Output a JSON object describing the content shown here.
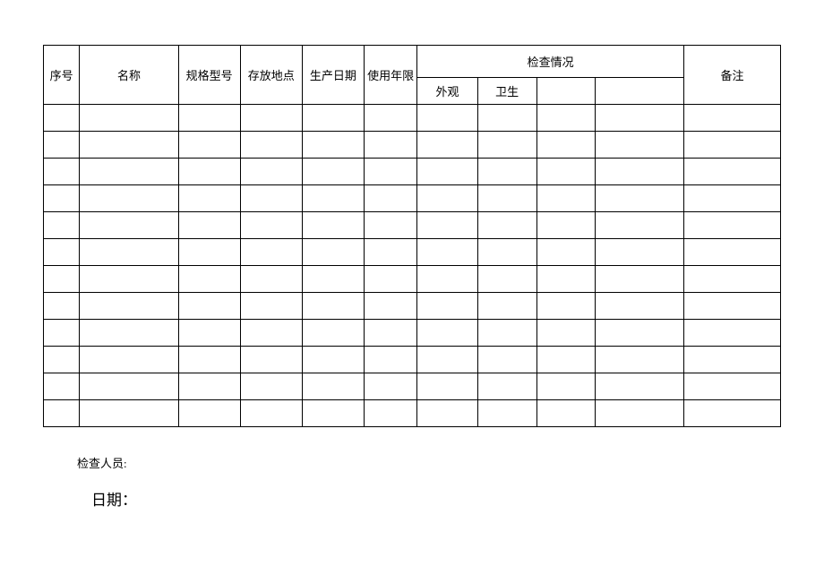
{
  "headers": {
    "seq": "序号",
    "name": "名称",
    "spec": "规格型号",
    "location": "存放地点",
    "prod_date": "生产日期",
    "lifetime": "使用年限",
    "inspection": "检查情况",
    "remark": "备注"
  },
  "sub_headers": {
    "appearance": "外观",
    "hygiene": "卫生",
    "sub3": "",
    "sub4": ""
  },
  "rows": [
    {
      "seq": "",
      "name": "",
      "spec": "",
      "loc": "",
      "date": "",
      "life": "",
      "s1": "",
      "s2": "",
      "s3": "",
      "s4": "",
      "remark": ""
    },
    {
      "seq": "",
      "name": "",
      "spec": "",
      "loc": "",
      "date": "",
      "life": "",
      "s1": "",
      "s2": "",
      "s3": "",
      "s4": "",
      "remark": ""
    },
    {
      "seq": "",
      "name": "",
      "spec": "",
      "loc": "",
      "date": "",
      "life": "",
      "s1": "",
      "s2": "",
      "s3": "",
      "s4": "",
      "remark": ""
    },
    {
      "seq": "",
      "name": "",
      "spec": "",
      "loc": "",
      "date": "",
      "life": "",
      "s1": "",
      "s2": "",
      "s3": "",
      "s4": "",
      "remark": ""
    },
    {
      "seq": "",
      "name": "",
      "spec": "",
      "loc": "",
      "date": "",
      "life": "",
      "s1": "",
      "s2": "",
      "s3": "",
      "s4": "",
      "remark": ""
    },
    {
      "seq": "",
      "name": "",
      "spec": "",
      "loc": "",
      "date": "",
      "life": "",
      "s1": "",
      "s2": "",
      "s3": "",
      "s4": "",
      "remark": ""
    },
    {
      "seq": "",
      "name": "",
      "spec": "",
      "loc": "",
      "date": "",
      "life": "",
      "s1": "",
      "s2": "",
      "s3": "",
      "s4": "",
      "remark": ""
    },
    {
      "seq": "",
      "name": "",
      "spec": "",
      "loc": "",
      "date": "",
      "life": "",
      "s1": "",
      "s2": "",
      "s3": "",
      "s4": "",
      "remark": ""
    },
    {
      "seq": "",
      "name": "",
      "spec": "",
      "loc": "",
      "date": "",
      "life": "",
      "s1": "",
      "s2": "",
      "s3": "",
      "s4": "",
      "remark": ""
    },
    {
      "seq": "",
      "name": "",
      "spec": "",
      "loc": "",
      "date": "",
      "life": "",
      "s1": "",
      "s2": "",
      "s3": "",
      "s4": "",
      "remark": ""
    },
    {
      "seq": "",
      "name": "",
      "spec": "",
      "loc": "",
      "date": "",
      "life": "",
      "s1": "",
      "s2": "",
      "s3": "",
      "s4": "",
      "remark": ""
    },
    {
      "seq": "",
      "name": "",
      "spec": "",
      "loc": "",
      "date": "",
      "life": "",
      "s1": "",
      "s2": "",
      "s3": "",
      "s4": "",
      "remark": ""
    }
  ],
  "footer": {
    "inspector_label": "检查人员:",
    "date_label": "日期："
  }
}
